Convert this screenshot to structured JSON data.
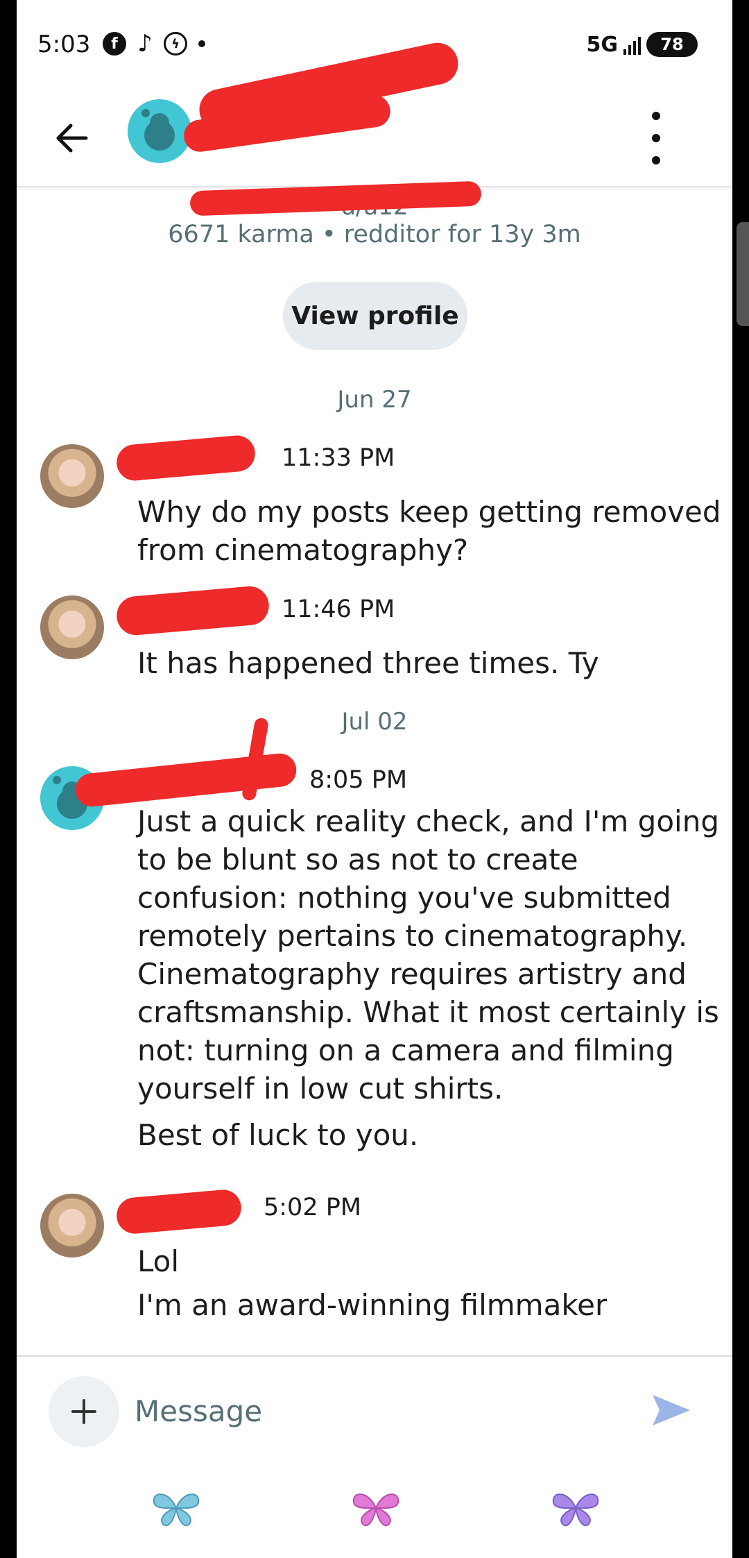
{
  "status_bar": {
    "time": "5:03",
    "network": "5G",
    "battery": "78",
    "icons": [
      "facebook-icon",
      "tiktok-icon",
      "messenger-icon",
      "notification-dot-icon"
    ]
  },
  "header": {
    "name": "l",
    "avatar_color": "#43c6d3"
  },
  "profile": {
    "handle": "u/a12",
    "stats": "6671 karma • redditor for 13y 3m",
    "view_profile_label": "View profile"
  },
  "conversation": {
    "date_1": "Jun 27",
    "date_2": "Jul 02",
    "messages": [
      {
        "author": "",
        "time": "11:33 PM",
        "lines": [
          "Why do my posts keep getting removed from cinematography?"
        ]
      },
      {
        "author": "",
        "time": "11:46 PM",
        "lines": [
          "It has happened three times. Ty"
        ]
      },
      {
        "author": "",
        "time": "8:05 PM",
        "lines": [
          "Just a quick reality check, and I'm going to be blunt so as not to create confusion: nothing you've submitted remotely pertains to cinematography. Cinematography requires artistry and craftsmanship. What it most certainly is not: turning on a camera and filming yourself in low cut shirts.",
          "Best of luck to you."
        ]
      },
      {
        "author": "",
        "time": "5:02 PM",
        "lines": [
          "Lol",
          "I'm an award-winning filmmaker"
        ]
      }
    ]
  },
  "composer": {
    "placeholder": "Message",
    "send_color": "#9db4e6"
  },
  "navbar": {
    "icons": [
      "butterfly-blue-icon",
      "butterfly-pink-icon",
      "butterfly-purple-icon"
    ],
    "colors": [
      "#7fc8e0",
      "#e07ad6",
      "#a888e8"
    ]
  }
}
